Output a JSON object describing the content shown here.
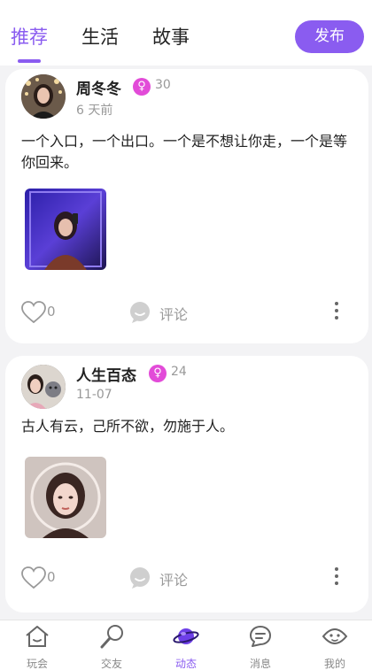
{
  "header": {
    "tabs": [
      {
        "label": "推荐",
        "active": true
      },
      {
        "label": "生活",
        "active": false
      },
      {
        "label": "故事",
        "active": false
      }
    ],
    "publish_label": "发布"
  },
  "posts": [
    {
      "name": "周冬冬",
      "gender_symbol": "♀",
      "age": "30",
      "time": "6 天前",
      "text": "一个入口，一个出口。一个是不想让你走，一个是等你回来。",
      "likes": "0",
      "comment_label": "评论"
    },
    {
      "name": "人生百态",
      "gender_symbol": "♀",
      "age": "24",
      "time": "11-07",
      "text": "古人有云，己所不欲，勿施于人。",
      "likes": "0",
      "comment_label": "评论"
    }
  ],
  "bottom_nav": [
    {
      "label": "玩会",
      "icon": "home-icon",
      "active": false
    },
    {
      "label": "交友",
      "icon": "microphone-icon",
      "active": false
    },
    {
      "label": "动态",
      "icon": "planet-icon",
      "active": true
    },
    {
      "label": "消息",
      "icon": "message-icon",
      "active": false
    },
    {
      "label": "我的",
      "icon": "profile-face-icon",
      "active": false
    }
  ],
  "colors": {
    "accent": "#8a5cf0",
    "gender_badge": "#e24bd8",
    "muted_text": "#999999",
    "page_background": "#f3f3f5"
  }
}
